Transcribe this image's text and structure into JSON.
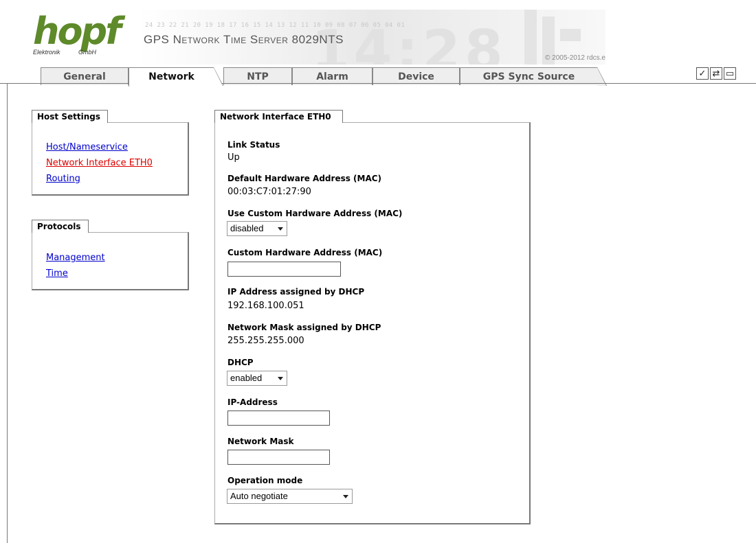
{
  "header": {
    "logo_text": "hopf",
    "logo_sub_left": "Elektronik",
    "logo_sub_right": "GmbH",
    "number_strip": "24 23 22 21 20 19 18 17 16 15 14 13 12 11 10 09 08 07 06 05 04 01",
    "title": "GPS Network Time Server 8029NTS",
    "copyright_prefix": "© 2005-2012",
    "copyright_link": "rdcs.eu",
    "bg_clock": "14:28"
  },
  "tabs": [
    {
      "label": "General",
      "active": false
    },
    {
      "label": "Network",
      "active": true
    },
    {
      "label": "NTP",
      "active": false
    },
    {
      "label": "Alarm",
      "active": false
    },
    {
      "label": "Device",
      "active": false
    },
    {
      "label": "GPS Sync Source",
      "active": false
    }
  ],
  "toolbar_icons": [
    "check-icon",
    "reload-icon",
    "page-icon"
  ],
  "host_settings": {
    "title": "Host Settings",
    "links": [
      {
        "label": "Host/Nameservice",
        "active": false
      },
      {
        "label": "Network Interface ETH0",
        "active": true
      },
      {
        "label": "Routing",
        "active": false
      }
    ]
  },
  "protocols": {
    "title": "Protocols",
    "links": [
      {
        "label": "Management",
        "active": false
      },
      {
        "label": "Time",
        "active": false
      }
    ]
  },
  "eth0": {
    "title": "Network Interface ETH0",
    "link_status_label": "Link Status",
    "link_status_value": "Up",
    "default_mac_label": "Default Hardware Address (MAC)",
    "default_mac_value": "00:03:C7:01:27:90",
    "use_custom_mac_label": "Use Custom Hardware Address (MAC)",
    "use_custom_mac_value": "disabled",
    "custom_mac_label": "Custom Hardware Address (MAC)",
    "custom_mac_value": "",
    "dhcp_ip_label": "IP Address assigned by DHCP",
    "dhcp_ip_value": "192.168.100.051",
    "dhcp_mask_label": "Network Mask assigned by DHCP",
    "dhcp_mask_value": "255.255.255.000",
    "dhcp_label": "DHCP",
    "dhcp_value": "enabled",
    "ip_label": "IP-Address",
    "ip_value": "",
    "mask_label": "Network Mask",
    "mask_value": "",
    "opmode_label": "Operation mode",
    "opmode_value": "Auto negotiate"
  },
  "colors": {
    "logo_green": "#5e8a2a",
    "link_blue": "#0000cc",
    "link_active_red": "#dd0000"
  }
}
